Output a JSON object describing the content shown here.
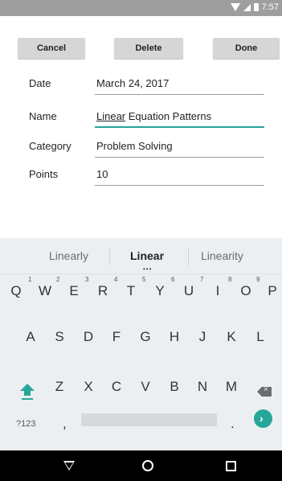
{
  "status_bar": {
    "time": "7:57"
  },
  "actions": {
    "cancel": "Cancel",
    "delete": "Delete",
    "done": "Done"
  },
  "form": {
    "fields": [
      {
        "label": "Date",
        "value": "March 24, 2017"
      },
      {
        "label": "Name",
        "value_underlined": "Linear",
        "value_rest": " Equation Patterns"
      },
      {
        "label": "Category",
        "value": "Problem Solving"
      },
      {
        "label": "Points",
        "value": "10"
      }
    ]
  },
  "keyboard": {
    "suggestions": [
      "Linearly",
      "Linear",
      "Linearity"
    ],
    "row1": [
      "Q",
      "W",
      "E",
      "R",
      "T",
      "Y",
      "U",
      "I",
      "O",
      "P"
    ],
    "row1_numbers": [
      "1",
      "2",
      "3",
      "4",
      "5",
      "6",
      "7",
      "8",
      "9"
    ],
    "row2": [
      "A",
      "S",
      "D",
      "F",
      "G",
      "H",
      "J",
      "K",
      "L"
    ],
    "row3": [
      "Z",
      "X",
      "C",
      "V",
      "B",
      "N",
      "M"
    ],
    "symbols_key": "?123",
    "comma": ",",
    "period": ".",
    "accent_color": "#26a69a"
  },
  "icons": {
    "shift": "shift-icon",
    "backspace": "backspace-icon",
    "go": "go-arrow-icon",
    "back": "nav-back-icon",
    "home": "nav-home-icon",
    "recents": "nav-recents-icon"
  }
}
